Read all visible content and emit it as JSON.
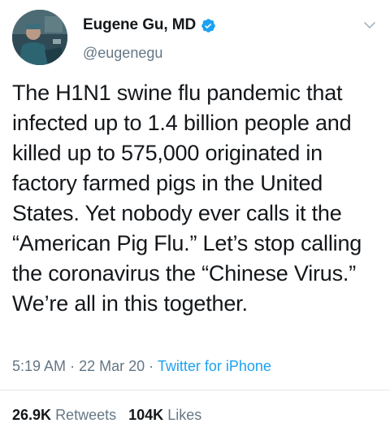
{
  "author": {
    "display_name": "Eugene Gu, MD",
    "handle": "@eugenegu",
    "verified": true,
    "avatar_icon": "avatar-surgeon-photo"
  },
  "tweet": {
    "text": "The H1N1 swine flu pandemic that infected up to 1.4 billion people and killed up to 575,000 originated in factory farmed pigs in the United States. Yet nobody ever calls it the “American Pig Flu.” Let’s stop calling the coronavirus the “Chinese Virus.” We’re all in this together.",
    "time": "5:19 AM",
    "date": "22 Mar 20",
    "separator": "·",
    "source": "Twitter for iPhone"
  },
  "stats": {
    "retweets_count": "26.9K",
    "retweets_label": "Retweets",
    "likes_count": "104K",
    "likes_label": "Likes"
  },
  "colors": {
    "text": "#14171a",
    "secondary": "#657786",
    "accent": "#1da1f2",
    "divider": "#e1e8ed"
  },
  "icons": {
    "verified": "verified-badge-icon",
    "menu": "chevron-down-icon"
  }
}
